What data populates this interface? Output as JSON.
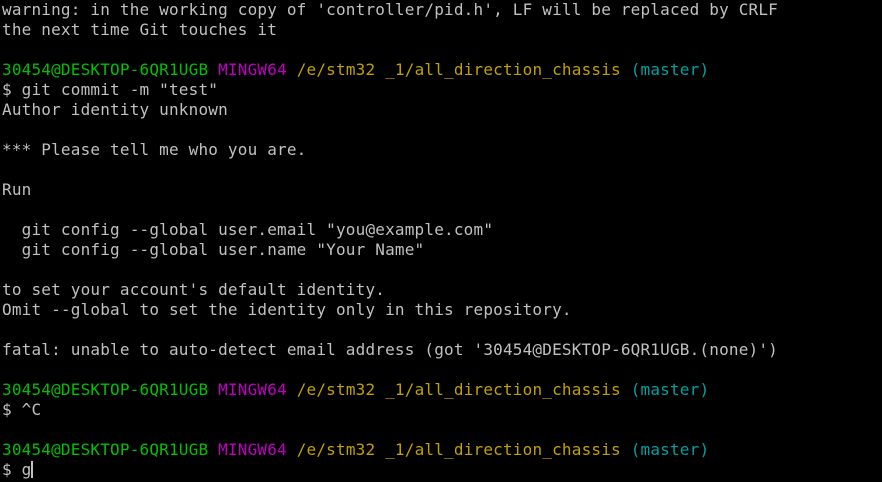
{
  "terminal": {
    "colors": {
      "background": "#000000",
      "text": "#c0c0c0",
      "user_host": "#00c000",
      "shell": "#c000c0",
      "path": "#c0a000",
      "branch": "#00a0a0"
    },
    "lines": [
      {
        "kind": "text",
        "text": "warning: in the working copy of 'controller/pid.h', LF will be replaced by CRLF"
      },
      {
        "kind": "text",
        "text": "the next time Git touches it"
      },
      {
        "kind": "text",
        "text": ""
      },
      {
        "kind": "prompt",
        "user_host": "30454@DESKTOP-6QR1UGB",
        "shell": "MINGW64",
        "path": "/e/stm32 _1/all_direction_chassis",
        "branch": "(master)"
      },
      {
        "kind": "text",
        "text": "$ git commit -m \"test\""
      },
      {
        "kind": "text",
        "text": "Author identity unknown"
      },
      {
        "kind": "text",
        "text": ""
      },
      {
        "kind": "text",
        "text": "*** Please tell me who you are."
      },
      {
        "kind": "text",
        "text": ""
      },
      {
        "kind": "text",
        "text": "Run"
      },
      {
        "kind": "text",
        "text": ""
      },
      {
        "kind": "text",
        "text": "  git config --global user.email \"you@example.com\""
      },
      {
        "kind": "text",
        "text": "  git config --global user.name \"Your Name\""
      },
      {
        "kind": "text",
        "text": ""
      },
      {
        "kind": "text",
        "text": "to set your account's default identity."
      },
      {
        "kind": "text",
        "text": "Omit --global to set the identity only in this repository."
      },
      {
        "kind": "text",
        "text": ""
      },
      {
        "kind": "text",
        "text": "fatal: unable to auto-detect email address (got '30454@DESKTOP-6QR1UGB.(none)')"
      },
      {
        "kind": "text",
        "text": ""
      },
      {
        "kind": "prompt",
        "user_host": "30454@DESKTOP-6QR1UGB",
        "shell": "MINGW64",
        "path": "/e/stm32 _1/all_direction_chassis",
        "branch": "(master)"
      },
      {
        "kind": "text",
        "text": "$ ^C"
      },
      {
        "kind": "text",
        "text": ""
      },
      {
        "kind": "prompt",
        "user_host": "30454@DESKTOP-6QR1UGB",
        "shell": "MINGW64",
        "path": "/e/stm32 _1/all_direction_chassis",
        "branch": "(master)"
      },
      {
        "kind": "input",
        "text": "$ g"
      }
    ]
  }
}
